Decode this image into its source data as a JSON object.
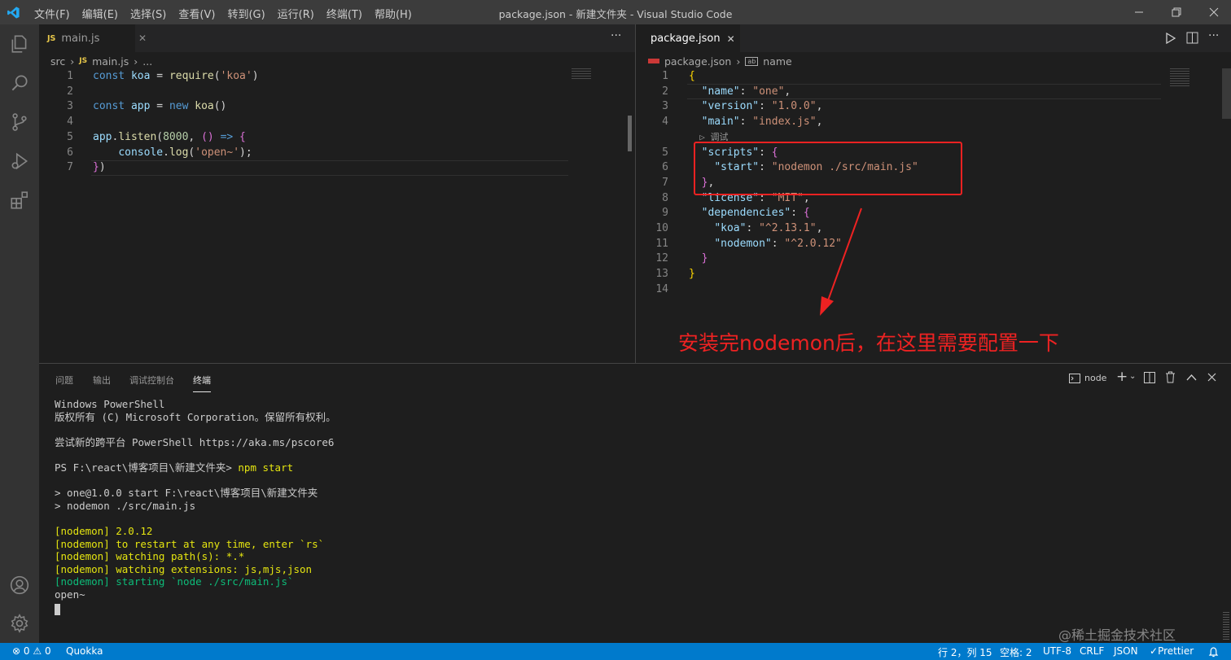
{
  "window": {
    "title": "package.json - 新建文件夹 - Visual Studio Code",
    "menu": [
      "文件(F)",
      "编辑(E)",
      "选择(S)",
      "查看(V)",
      "转到(G)",
      "运行(R)",
      "终端(T)",
      "帮助(H)"
    ]
  },
  "activity_icons": [
    "explorer-icon",
    "search-icon",
    "source-control-icon",
    "run-debug-icon",
    "extensions-icon",
    "account-icon",
    "settings-gear-icon"
  ],
  "left_editor": {
    "tab": {
      "badge": "JS",
      "label": "main.js"
    },
    "breadcrumb": {
      "folder": "src",
      "badge": "JS",
      "file": "main.js",
      "more": "..."
    },
    "line_numbers": [
      "1",
      "2",
      "3",
      "4",
      "5",
      "6",
      "7"
    ]
  },
  "right_editor": {
    "tab": {
      "label": "package.json"
    },
    "breadcrumb": {
      "file": "package.json",
      "symbol": "name"
    },
    "line_numbers": [
      "1",
      "2",
      "3",
      "4",
      "5",
      "6",
      "7",
      "8",
      "9",
      "10",
      "11",
      "12",
      "13",
      "14"
    ],
    "codelens": "调试"
  },
  "annotation": {
    "text": "安装完nodemon后，在这里需要配置一下",
    "color": "#ee2222"
  },
  "panel": {
    "tabs": [
      "问题",
      "输出",
      "调试控制台",
      "终端"
    ],
    "active_tab": "终端",
    "terminal_name": "node"
  },
  "terminal": {
    "lines_plain": [
      "Windows PowerShell",
      "版权所有 (C) Microsoft Corporation。保留所有权利。",
      "",
      "尝试新的跨平台 PowerShell https://aka.ms/pscore6",
      ""
    ],
    "prompt": "PS F:\\react\\博客项目\\新建文件夹> ",
    "command": "npm start",
    "lines_output": [
      "",
      "> one@1.0.0 start F:\\react\\博客项目\\新建文件夹",
      "> nodemon ./src/main.js",
      ""
    ],
    "lines_yellow": [
      "[nodemon] 2.0.12",
      "[nodemon] to restart at any time, enter `rs`",
      "[nodemon] watching path(s): *.*",
      "[nodemon] watching extensions: js,mjs,json"
    ],
    "line_green": "[nodemon] starting `node ./src/main.js`",
    "line_last": "open~"
  },
  "watermark": "@稀土掘金技术社区",
  "statusbar": {
    "errors": "0",
    "warnings": "0",
    "quokka": "Quokka",
    "position": "行 2，列 15",
    "spaces": "空格: 2",
    "encoding": "UTF-8",
    "eol": "CRLF",
    "language": "JSON",
    "prettier": "Prettier"
  }
}
